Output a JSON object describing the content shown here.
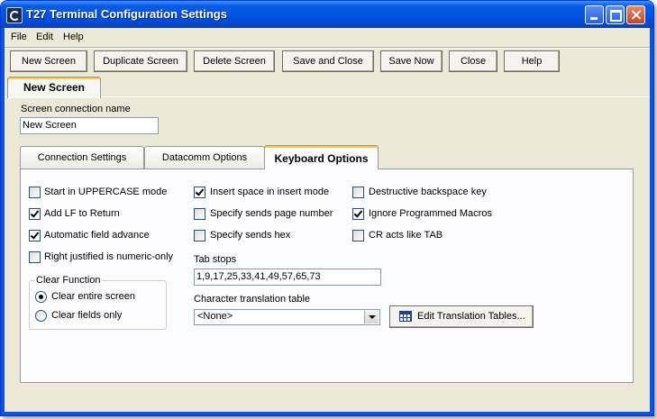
{
  "window": {
    "title": "T27 Terminal Configuration Settings"
  },
  "menu": {
    "file": "File",
    "edit": "Edit",
    "help": "Help"
  },
  "toolbar": {
    "new_screen": "New Screen",
    "duplicate_screen": "Duplicate Screen",
    "delete_screen": "Delete Screen",
    "save_and_close": "Save and Close",
    "save_now": "Save Now",
    "close": "Close",
    "help": "Help"
  },
  "outer_tab": {
    "label": "New Screen"
  },
  "connection_name": {
    "label": "Screen connection name",
    "value": "New Screen"
  },
  "tabs": {
    "connection_settings": "Connection Settings",
    "datacomm_options": "Datacomm Options",
    "keyboard_options": "Keyboard Options"
  },
  "keyboard": {
    "start_uppercase": {
      "label": "Start in UPPERCASE mode",
      "checked": false
    },
    "add_lf_to_return": {
      "label": "Add LF to Return",
      "checked": true
    },
    "automatic_field_advance": {
      "label": "Automatic field advance",
      "checked": true
    },
    "right_justified_numeric": {
      "label": "Right justified is numeric-only",
      "checked": false
    },
    "insert_space": {
      "label": "Insert space in insert mode",
      "checked": true
    },
    "specify_page_number": {
      "label": "Specify sends page number",
      "checked": false
    },
    "specify_hex": {
      "label": "Specify sends hex",
      "checked": false
    },
    "destructive_backspace": {
      "label": "Destructive backspace key",
      "checked": false
    },
    "ignore_macros": {
      "label": "Ignore Programmed Macros",
      "checked": true
    },
    "cr_acts_like_tab": {
      "label": "CR acts like TAB",
      "checked": false
    }
  },
  "clear_function": {
    "title": "Clear Function",
    "entire_screen": "Clear entire screen",
    "fields_only": "Clear fields only",
    "selected": "entire_screen"
  },
  "tab_stops": {
    "label": "Tab stops",
    "value": "1,9,17,25,33,41,49,57,65,73"
  },
  "translation": {
    "label": "Character translation table",
    "selected": "<None>",
    "edit_button": "Edit Translation Tables..."
  },
  "icons": {
    "app": "terminal-app-icon",
    "edit_tables": "table-grid-icon"
  }
}
